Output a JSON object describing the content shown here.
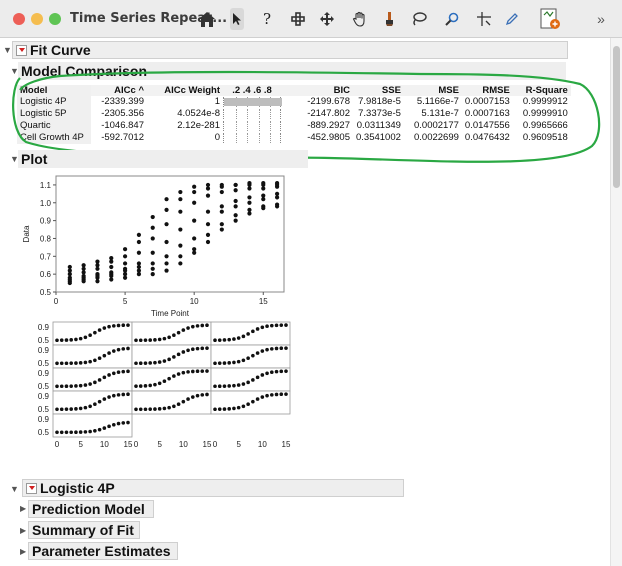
{
  "window": {
    "title": "Time Series Repeat...",
    "toolbar_icons": [
      "home-icon",
      "arrow-pointer-icon",
      "help-icon",
      "crosshair-icon",
      "move-icon",
      "hand-icon",
      "brush-icon",
      "lasso-icon",
      "magnifier-icon",
      "scale-icon",
      "pen-icon",
      "annotate-icon",
      "chevron-right-icon"
    ]
  },
  "sections": {
    "fit_curve": "Fit Curve",
    "model_comparison": "Model Comparison",
    "plot": "Plot",
    "logistic4p": "Logistic 4P",
    "prediction_model": "Prediction Model",
    "summary_of_fit": "Summary of Fit",
    "parameter_estimates": "Parameter Estimates"
  },
  "model_table": {
    "headers": {
      "model": "Model",
      "aicc": "AICc ^",
      "aicc_weight": "AICc Weight",
      "scale": ".2 .4 .6 .8",
      "bic": "BIC",
      "sse": "SSE",
      "mse": "MSE",
      "rmse": "RMSE",
      "rsquare": "R-Square"
    },
    "rows": [
      {
        "model": "Logistic 4P",
        "aicc": "-2339.399",
        "weight": "1",
        "weight_value": 1.0,
        "bic": "-2199.678",
        "sse": "7.9818e-5",
        "mse": "5.1166e-7",
        "rmse": "0.0007153",
        "rsq": "0.9999912"
      },
      {
        "model": "Logistic 5P",
        "aicc": "-2305.356",
        "weight": "4.0524e-8",
        "weight_value": 0.0,
        "bic": "-2147.802",
        "sse": "7.3373e-5",
        "mse": "5.131e-7",
        "rmse": "0.0007163",
        "rsq": "0.9999910"
      },
      {
        "model": "Quartic",
        "aicc": "-1046.847",
        "weight": "2.12e-281",
        "weight_value": 0.0,
        "bic": "-889.2927",
        "sse": "0.0311349",
        "mse": "0.0002177",
        "rmse": "0.0147556",
        "rsq": "0.9965666"
      },
      {
        "model": "Cell Growth 4P",
        "aicc": "-592.7012",
        "weight": "0",
        "weight_value": 0.0,
        "bic": "-452.9805",
        "sse": "0.3541002",
        "mse": "0.0022699",
        "rmse": "0.0476432",
        "rsq": "0.9609518"
      }
    ]
  },
  "chart_data": [
    {
      "type": "scatter",
      "xlabel": "Time Point",
      "ylabel": "Data",
      "xlim": [
        0,
        16.5
      ],
      "ylim": [
        0.5,
        1.15
      ],
      "x_ticks": [
        "0",
        "5",
        "10",
        "15"
      ],
      "y_ticks": [
        "0.5",
        "0.6",
        "0.7",
        "0.8",
        "0.9",
        "1.0",
        "1.1"
      ],
      "x": [
        1,
        2,
        3,
        4,
        5,
        6,
        7,
        8,
        9,
        10,
        11,
        12,
        13,
        14,
        15,
        16
      ],
      "series_cols": [
        [
          0.56,
          0.58,
          0.6,
          0.62,
          0.64,
          0.57,
          0.55
        ],
        [
          0.57,
          0.59,
          0.61,
          0.63,
          0.65,
          0.58,
          0.56
        ],
        [
          0.58,
          0.6,
          0.63,
          0.65,
          0.67,
          0.59,
          0.56
        ],
        [
          0.59,
          0.61,
          0.64,
          0.67,
          0.69,
          0.6,
          0.57
        ],
        [
          0.6,
          0.63,
          0.66,
          0.7,
          0.74,
          0.62,
          0.58
        ],
        [
          0.62,
          0.66,
          0.72,
          0.78,
          0.82,
          0.6,
          0.64
        ],
        [
          0.63,
          0.72,
          0.8,
          0.86,
          0.92,
          0.66,
          0.6
        ],
        [
          0.66,
          0.78,
          0.88,
          0.96,
          1.02,
          0.7,
          0.62
        ],
        [
          0.7,
          0.85,
          0.95,
          1.02,
          1.06,
          0.76,
          0.66
        ],
        [
          0.74,
          0.9,
          1.0,
          1.06,
          1.09,
          0.8,
          0.72
        ],
        [
          0.82,
          0.95,
          1.04,
          1.08,
          1.1,
          0.88,
          0.78
        ],
        [
          0.88,
          0.98,
          1.06,
          1.09,
          1.1,
          0.95,
          0.85
        ],
        [
          0.93,
          1.01,
          1.07,
          1.1,
          1.1,
          0.98,
          0.9
        ],
        [
          0.96,
          1.03,
          1.08,
          1.1,
          1.11,
          1.0,
          0.94
        ],
        [
          0.98,
          1.04,
          1.08,
          1.1,
          1.11,
          1.02,
          0.97
        ],
        [
          0.99,
          1.05,
          1.09,
          1.1,
          1.11,
          1.03,
          0.98
        ]
      ]
    },
    {
      "type": "line",
      "panel_rows": 5,
      "panel_cols": 3,
      "y_ticks": [
        "0.9",
        "0.5",
        "0.9",
        "0.5",
        "0.9",
        "0.5",
        "0.9",
        "0.5",
        "0.9",
        "0.5"
      ],
      "x_ticks": [
        "0",
        "5",
        "10",
        "15"
      ],
      "panel_count": 13,
      "panel_midpoints": [
        8,
        9,
        7.5,
        10,
        8.5,
        8,
        9.5,
        7,
        8.5,
        9,
        10,
        8,
        10.5
      ],
      "panel_ranges": [
        [
          0.55,
          1.0
        ],
        [
          0.55,
          1.0
        ],
        [
          0.55,
          1.0
        ],
        [
          0.55,
          1.0
        ],
        [
          0.55,
          1.0
        ],
        [
          0.55,
          1.0
        ],
        [
          0.55,
          1.0
        ],
        [
          0.55,
          1.0
        ],
        [
          0.55,
          1.0
        ],
        [
          0.55,
          1.0
        ],
        [
          0.55,
          1.0
        ],
        [
          0.55,
          1.0
        ],
        [
          0.55,
          0.85
        ]
      ]
    }
  ]
}
